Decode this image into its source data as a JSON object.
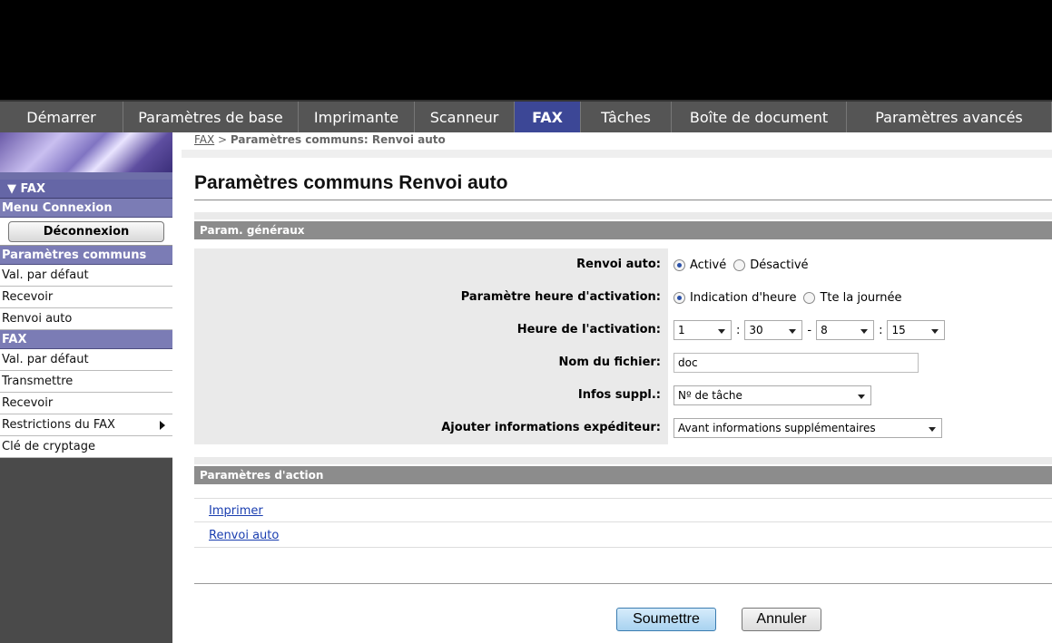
{
  "tabs": [
    {
      "label": "Démarrer",
      "active": false
    },
    {
      "label": "Paramètres de base",
      "active": false
    },
    {
      "label": "Imprimante",
      "active": false
    },
    {
      "label": "Scanneur",
      "active": false
    },
    {
      "label": "FAX",
      "active": true
    },
    {
      "label": "Tâches",
      "active": false
    },
    {
      "label": "Boîte de document",
      "active": false
    },
    {
      "label": "Paramètres avancés",
      "active": false
    }
  ],
  "sidebar": {
    "section_fax": "▼ FAX",
    "menu_connexion": "Menu Connexion",
    "logout_button": "Déconnexion",
    "common_params_header": "Paramètres communs",
    "common_items": [
      "Val. par défaut",
      "Recevoir",
      "Renvoi auto"
    ],
    "fax_header": "FAX",
    "fax_items": [
      "Val. par défaut",
      "Transmettre",
      "Recevoir",
      "Restrictions du FAX",
      "Clé de cryptage"
    ]
  },
  "breadcrumb": {
    "link": "FAX",
    "separator": " > ",
    "current": "Paramètres communs: Renvoi auto"
  },
  "page_title": "Paramètres communs Renvoi auto",
  "general": {
    "header": "Param. généraux",
    "renvoi_label": "Renvoi auto:",
    "renvoi_on": "Activé",
    "renvoi_off": "Désactivé",
    "activation_label": "Paramètre heure d'activation:",
    "activation_opt1": "Indication d'heure",
    "activation_opt2": "Tte la journée",
    "time_label": "Heure de l'activation:",
    "time_start_h": "1",
    "time_start_m": "30",
    "time_dash": "-",
    "time_end_h": "8",
    "time_end_m": "15",
    "time_colon": ":",
    "filename_label": "Nom du fichier:",
    "filename_value": "doc",
    "extra_label": "Infos suppl.:",
    "extra_value": "Nº de tâche",
    "sender_label": "Ajouter informations expéditeur:",
    "sender_value": "Avant informations supplémentaires"
  },
  "action": {
    "header": "Paramètres d'action",
    "links": [
      "Imprimer",
      "Renvoi auto"
    ]
  },
  "buttons": {
    "submit": "Soumettre",
    "cancel": "Annuler"
  }
}
